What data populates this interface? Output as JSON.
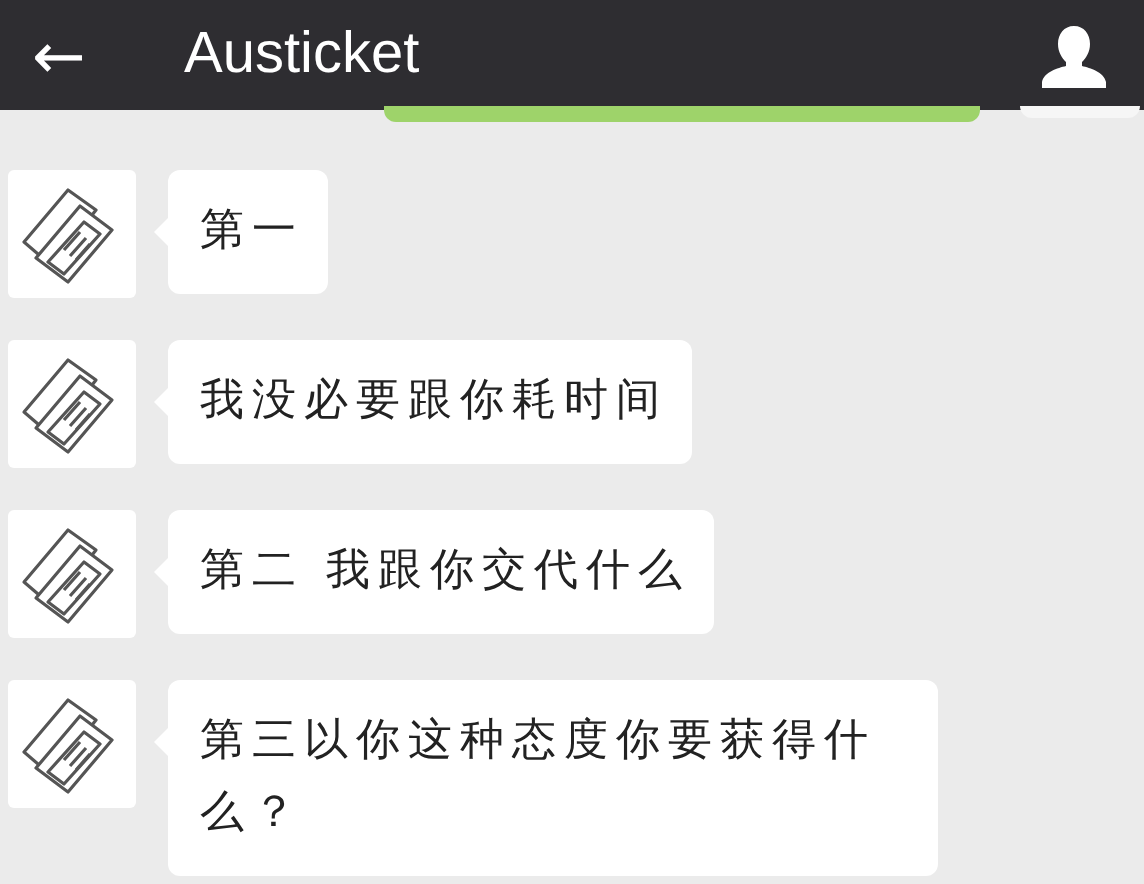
{
  "header": {
    "back": "←",
    "title": "Austicket"
  },
  "messages": [
    {
      "text": "第一"
    },
    {
      "text": "我没必要跟你耗时间"
    },
    {
      "text": "第二 我跟你交代什么"
    },
    {
      "text": "第三以你这种态度你要获得什么？"
    }
  ]
}
